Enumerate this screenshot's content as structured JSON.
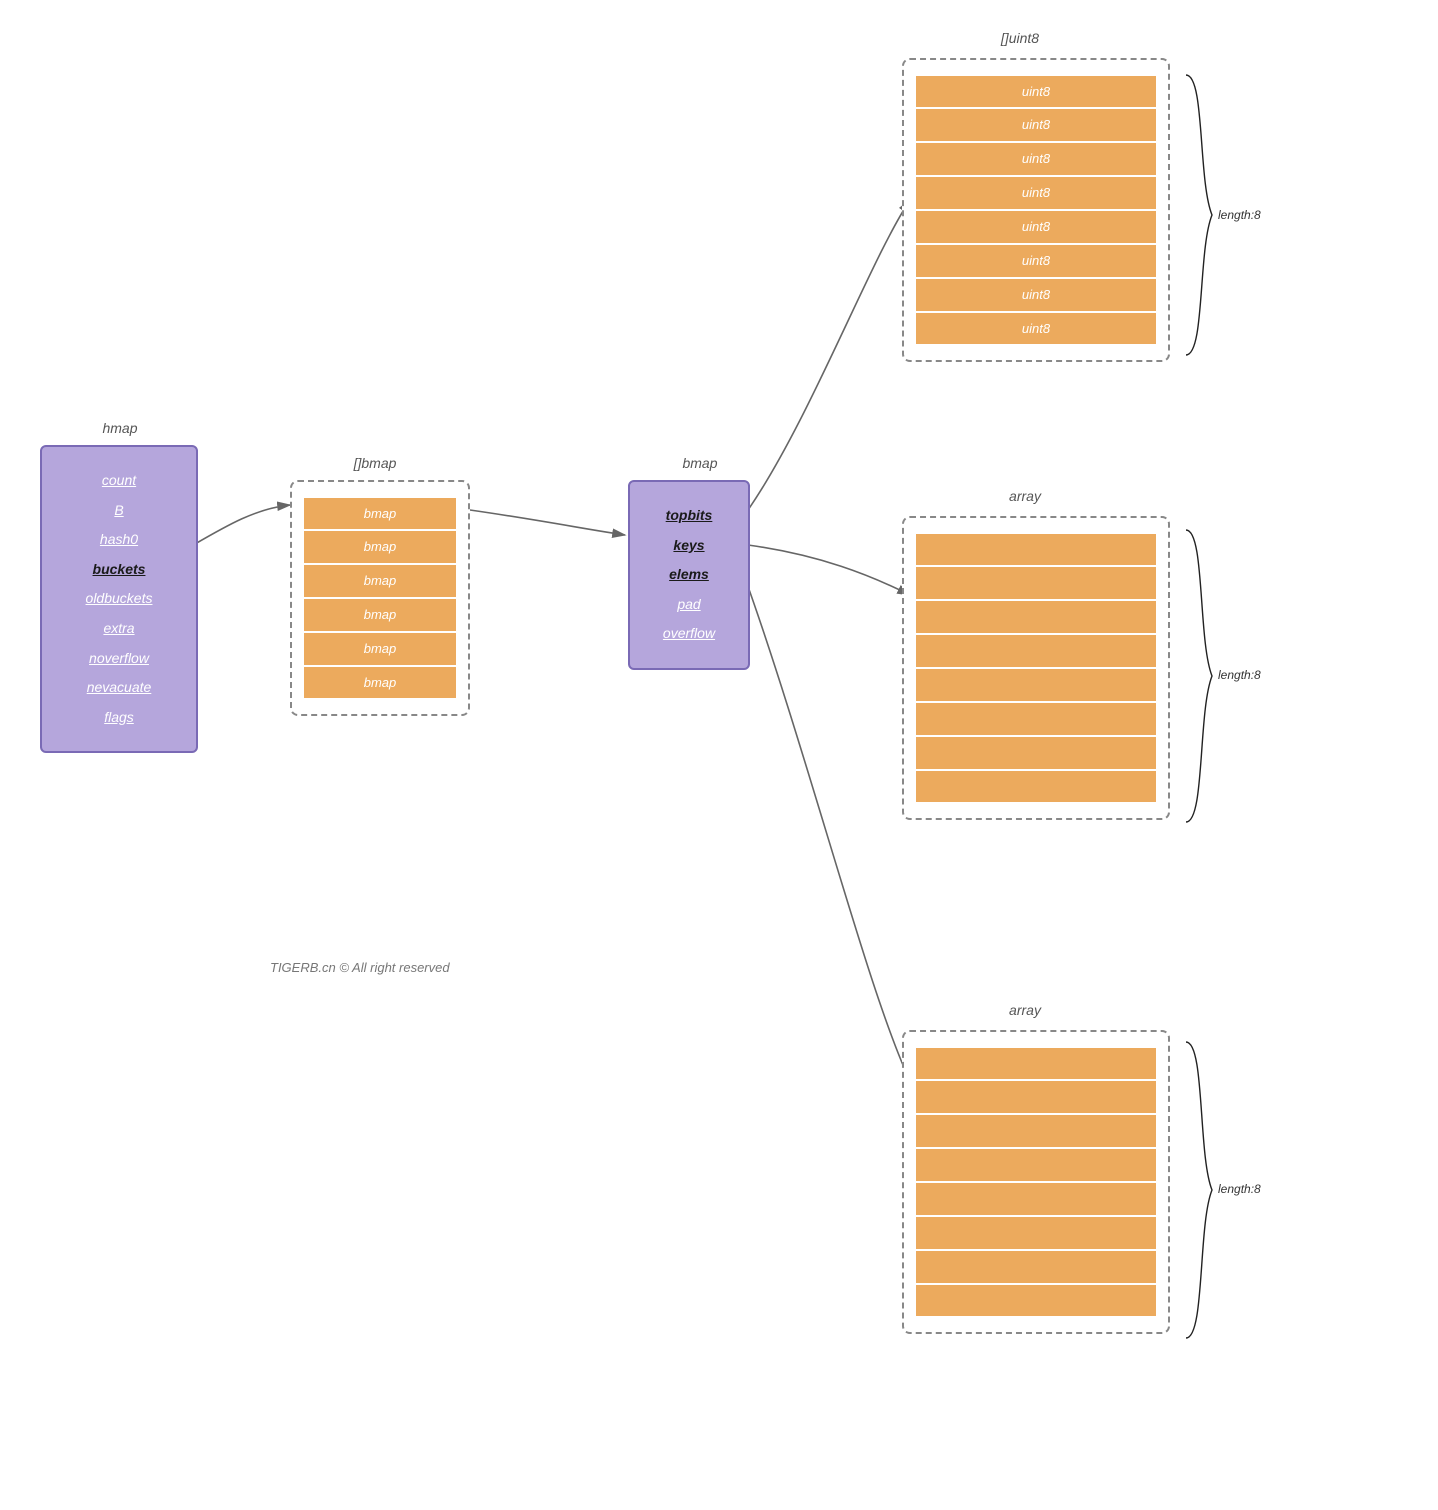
{
  "titles": {
    "hmap": "hmap",
    "bmap_slice": "[]bmap",
    "bmap": "bmap",
    "uint8_slice": "[]uint8",
    "array1": "array",
    "array2": "array"
  },
  "hmap": {
    "fields": [
      "count",
      "B",
      "hash0",
      "buckets",
      "oldbuckets",
      "extra",
      "noverflow",
      "nevacuate",
      "flags"
    ],
    "bold_index": 3
  },
  "bmap_slice": {
    "rows": [
      "bmap",
      "bmap",
      "bmap",
      "bmap",
      "bmap",
      "bmap"
    ]
  },
  "bmap": {
    "fields": [
      "topbits",
      "keys",
      "elems",
      "pad",
      "overflow"
    ],
    "bold_indices": [
      0,
      1,
      2
    ]
  },
  "uint8_slice": {
    "rows": [
      "uint8",
      "uint8",
      "uint8",
      "uint8",
      "uint8",
      "uint8",
      "uint8",
      "uint8"
    ],
    "length_label": "length:8"
  },
  "array1": {
    "rows": [
      "",
      "",
      "",
      "",
      "",
      "",
      "",
      ""
    ],
    "length_label": "length:8"
  },
  "array2": {
    "rows": [
      "",
      "",
      "",
      "",
      "",
      "",
      "",
      ""
    ],
    "length_label": "length:8"
  },
  "footer": "TIGERB.cn © All right reserved"
}
